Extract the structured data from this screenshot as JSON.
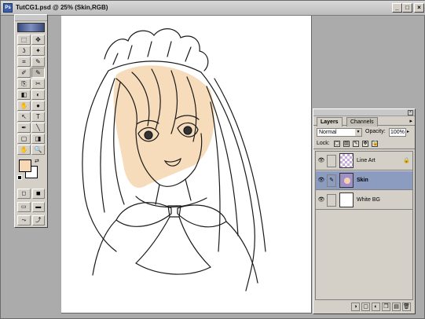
{
  "window": {
    "title": "TutCG1.psd @ 25% (Skin,RGB)",
    "icon": "ps-doc-icon"
  },
  "window_controls": {
    "minimize": "_",
    "maximize": "□",
    "close": "×"
  },
  "toolbox": {
    "tools": [
      "⬚",
      "✥",
      "ʖ",
      "✦",
      "⌗",
      "✎",
      "✐",
      "✎",
      "⎘",
      "✂",
      "◧",
      "◐",
      "✋",
      "●",
      "↖",
      "T",
      "✒",
      "╲",
      "▢",
      "◨",
      "✋",
      "🔍"
    ],
    "fg_color": "#f6d8b4",
    "bg_color": "#ffffff",
    "swap_glyph": "⇄",
    "mode_buttons": [
      "◻",
      "◼",
      "▭",
      "▬",
      "⤳",
      "⤴"
    ]
  },
  "layers_panel": {
    "tabs": [
      "Layers",
      "Channels"
    ],
    "menu_glyph": "▸",
    "blend_mode": "Normal",
    "opacity_label": "Opacity:",
    "opacity_value": "100%",
    "lock_label": "Lock:",
    "lock_icons": [
      "▢",
      "▨",
      "✎",
      "✥",
      "🔒"
    ],
    "layers": [
      {
        "name": "Line Art",
        "visible": true,
        "active": false,
        "locked": true,
        "thumb": "check"
      },
      {
        "name": "Skin",
        "visible": true,
        "active": true,
        "locked": false,
        "thumb": "skin"
      },
      {
        "name": "White BG",
        "visible": true,
        "active": false,
        "locked": false,
        "thumb": "white"
      }
    ],
    "eye_glyph": "👁",
    "brush_glyph": "✎",
    "lock_glyph": "🔒",
    "footer_buttons": [
      "◑",
      "▢",
      "◐",
      "❒",
      "▤",
      "🗑"
    ]
  }
}
